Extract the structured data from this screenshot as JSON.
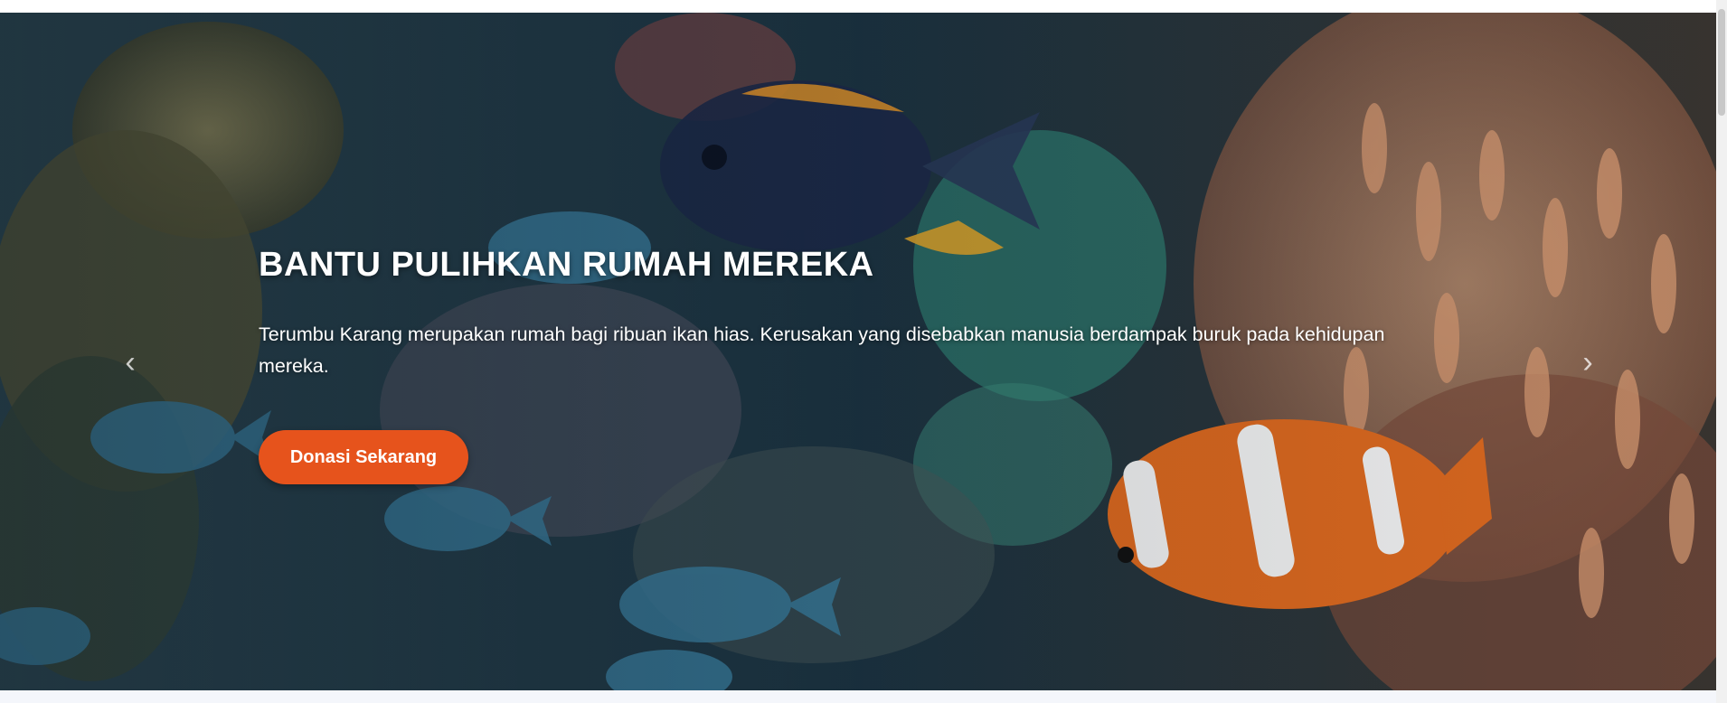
{
  "hero": {
    "title": "BANTU PULIHKAN RUMAH MEREKA",
    "description": "Terumbu Karang merupakan rumah bagi ribuan ikan hias. Kerusakan yang disebabkan manusia berdampak buruk pada kehidupan mereka.",
    "cta_label": "Donasi Sekarang",
    "prev_icon": "chevron-left-icon",
    "next_icon": "chevron-right-icon"
  },
  "colors": {
    "cta_background": "#e6531c",
    "text": "#ffffff"
  }
}
